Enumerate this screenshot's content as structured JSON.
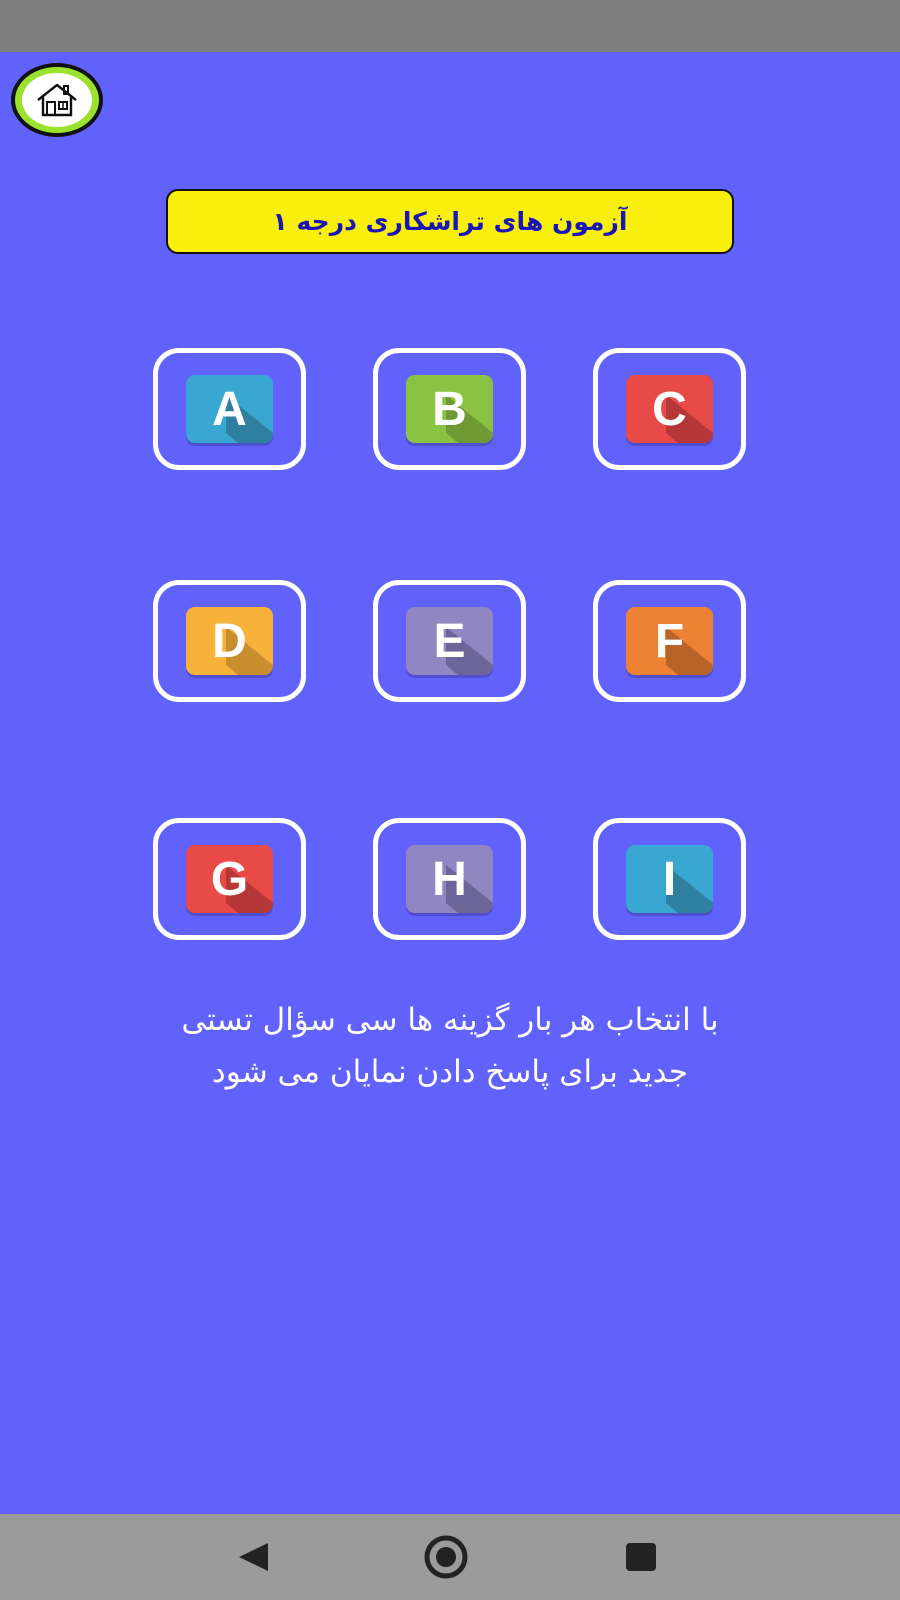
{
  "header": {
    "home_icon": "house-icon",
    "title": "آزمون های تراشکاری درجه ۱"
  },
  "tiles": [
    {
      "letter": "A",
      "color": "#3aa7d3",
      "shade": "#2f7fa0"
    },
    {
      "letter": "B",
      "color": "#8cc244",
      "shade": "#6f9a35"
    },
    {
      "letter": "C",
      "color": "#e84a48",
      "shade": "#b53737"
    },
    {
      "letter": "D",
      "color": "#f8b23a",
      "shade": "#c98e2e"
    },
    {
      "letter": "E",
      "color": "#8f86c2",
      "shade": "#6c6598"
    },
    {
      "letter": "F",
      "color": "#ee8234",
      "shade": "#b86428"
    },
    {
      "letter": "G",
      "color": "#e84a48",
      "shade": "#b53737"
    },
    {
      "letter": "H",
      "color": "#8f86c2",
      "shade": "#6c6598"
    },
    {
      "letter": "I",
      "color": "#3aa7d3",
      "shade": "#2f7fa0"
    }
  ],
  "info": {
    "line1": "با انتخاب هر بار گزینه ها سی سؤال تستی",
    "line2": "جدید برای پاسخ دادن نمایان می شود"
  },
  "navigation": {
    "back_icon": "back-triangle-icon",
    "home_icon": "home-circle-icon",
    "recents_icon": "recents-square-icon"
  },
  "colors": {
    "background": "#6161fb",
    "title_background": "#f8ef0c",
    "title_text": "#1a16b5",
    "status_bar": "#7f7f7f",
    "nav_bar": "#9b9b9b"
  }
}
